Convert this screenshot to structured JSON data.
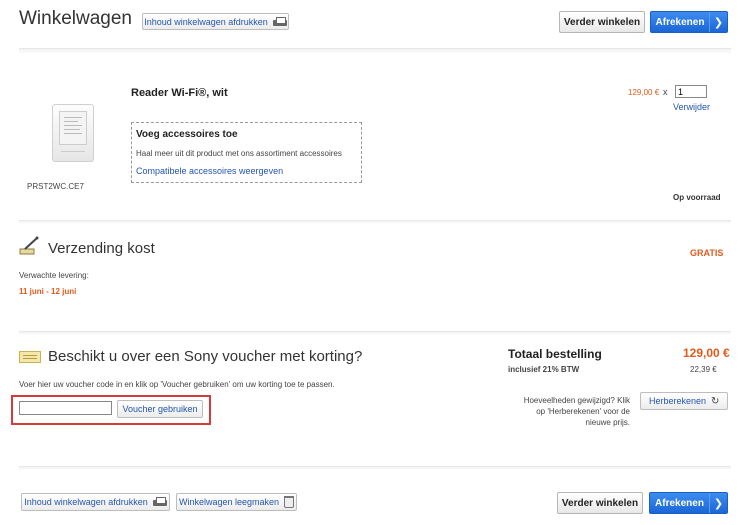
{
  "header": {
    "title": "Winkelwagen",
    "print_label": "Inhoud winkelwagen afdrukken",
    "continue_label": "Verder winkelen",
    "checkout_label": "Afrekenen"
  },
  "product": {
    "name": "Reader Wi-Fi®, wit",
    "sku": "PRST2WC.CE7",
    "price": "129,00 €",
    "times": "x",
    "quantity": "1",
    "remove_label": "Verwijder",
    "stock": "Op voorraad",
    "accessories": {
      "title": "Voeg accessoires toe",
      "description": "Haal meer uit dit product met ons assortiment accessoires",
      "link": "Compatibele accessoires weergeven"
    }
  },
  "shipping": {
    "title": "Verzending kost",
    "cost": "GRATIS",
    "delivery_label": "Verwachte levering:",
    "delivery_dates": "11 juni - 12 juni"
  },
  "voucher": {
    "title": "Beschikt u over een Sony voucher met korting?",
    "instruction": "Voer hier uw voucher code in en klik op 'Voucher gebruiken' om uw korting toe te passen.",
    "input_value": "",
    "button_label": "Voucher gebruiken"
  },
  "totals": {
    "label": "Totaal bestelling",
    "amount": "129,00 €",
    "vat_label": "inclusief 21% BTW",
    "vat_amount": "22,39 €",
    "recalc_hint": "Hoeveelheden gewijzigd? Klik op 'Herberekenen' voor de nieuwe prijs.",
    "recalc_label": "Herberekenen"
  },
  "footer": {
    "print_label": "Inhoud winkelwagen afdrukken",
    "empty_label": "Winkelwagen leegmaken",
    "continue_label": "Verder winkelen",
    "checkout_label": "Afrekenen"
  },
  "colors": {
    "accent_blue": "#1a66d6",
    "price_orange": "#e05a1c",
    "link_blue": "#2356b0",
    "highlight_red": "#d63a3a"
  }
}
